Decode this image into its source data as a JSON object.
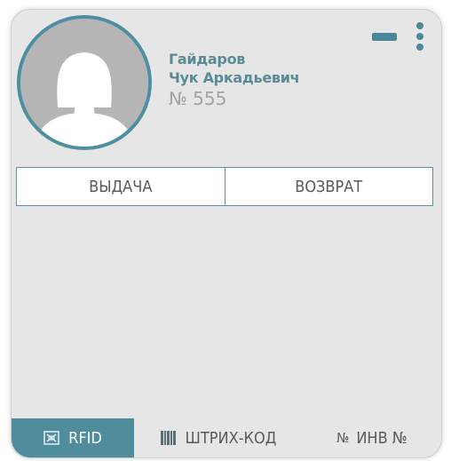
{
  "user": {
    "surname": "Гайдаров",
    "given_name": "Чук Аркадьевич",
    "number": "№ 555"
  },
  "icons": {
    "avatar": "female-silhouette-icon",
    "minimize": "minimize-icon",
    "menu": "kebab-menu-icon",
    "rfid": "rfid-icon",
    "barcode": "barcode-icon",
    "inventory": "number-sign-icon"
  },
  "tabs": [
    {
      "label": "ВЫДАЧА"
    },
    {
      "label": "ВОЗВРАТ"
    }
  ],
  "modes": [
    {
      "label": "RFID",
      "active": true
    },
    {
      "label": "ШТРИХ-КОД",
      "active": false
    },
    {
      "label": "ИНВ №",
      "prefix": "№",
      "active": false
    }
  ],
  "colors": {
    "accent": "#4f8d9c",
    "name_text": "#5a8a96",
    "card_background": "#e6e6e6"
  }
}
